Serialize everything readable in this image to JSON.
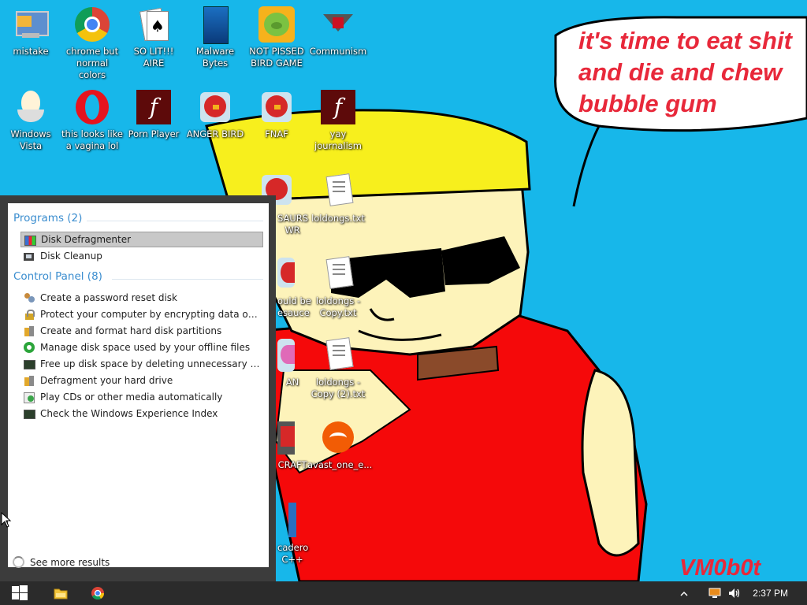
{
  "wallpaper": {
    "speech_text_1": "it's time to eat shit",
    "speech_text_2": "and die and chew",
    "speech_text_3": "bubble gum",
    "signature": "VM0b0t"
  },
  "desktop_icons": [
    {
      "label": "mistake",
      "icon": "computer-icon"
    },
    {
      "label": "chrome but normal colors",
      "icon": "chrome-icon"
    },
    {
      "label": "SO LIT!!! AIRE",
      "icon": "solitaire-icon"
    },
    {
      "label": "Malware Bytes",
      "icon": "malwarebytes-icon"
    },
    {
      "label": "NOT PISSED BIRD GAME",
      "icon": "pig-icon"
    },
    {
      "label": "Communism",
      "icon": "communism-icon"
    },
    {
      "label": "Windows Vista",
      "icon": "egg-icon"
    },
    {
      "label": "this looks like a vagina lol",
      "icon": "opera-icon"
    },
    {
      "label": "Porn Player",
      "icon": "flash-icon"
    },
    {
      "label": "ANGER BIRD",
      "icon": "angry-bird-icon"
    },
    {
      "label": "FNAF",
      "icon": "angry-bird-icon"
    },
    {
      "label": "yay journalism",
      "icon": "flash-icon"
    },
    {
      "label": "SAURS\nWR",
      "icon": "angry-bird-icon"
    },
    {
      "label": "loldongs.txt",
      "icon": "text-file-icon"
    },
    {
      "label": "ould be\nesauce",
      "icon": "angry-bird-icon"
    },
    {
      "label": "loldongs - Copy.txt",
      "icon": "text-file-icon"
    },
    {
      "label": "AN",
      "icon": "angry-bird-icon"
    },
    {
      "label": "loldongs - Copy (2).txt",
      "icon": "text-file-icon"
    },
    {
      "label": "CRAFT",
      "icon": "angry-bird-icon"
    },
    {
      "label": "avast_one_e...",
      "icon": "avast-icon"
    },
    {
      "label": "cadero\nC++",
      "icon": "app-icon"
    }
  ],
  "start_menu": {
    "programs_title": "Programs (2)",
    "programs": [
      {
        "label": "Disk Defragmenter",
        "icon": "defrag-icon",
        "selected": true
      },
      {
        "label": "Disk Cleanup",
        "icon": "cleanup-icon",
        "selected": false
      }
    ],
    "control_panel_title": "Control Panel (8)",
    "control_panel": [
      {
        "label": "Create a password reset disk",
        "icon": "users-icon"
      },
      {
        "label": "Protect your computer by encrypting data on your ...",
        "icon": "lock-icon"
      },
      {
        "label": "Create and format hard disk partitions",
        "icon": "tools-icon"
      },
      {
        "label": "Manage disk space used by your offline files",
        "icon": "sync-icon"
      },
      {
        "label": "Free up disk space by deleting unnecessary files",
        "icon": "monitor-icon"
      },
      {
        "label": "Defragment your hard drive",
        "icon": "tools-icon"
      },
      {
        "label": "Play CDs or other media automatically",
        "icon": "autoplay-icon"
      },
      {
        "label": "Check the Windows Experience Index",
        "icon": "monitor-icon"
      }
    ],
    "see_more": "See more results"
  },
  "taskbar": {
    "clock": "2:37 PM",
    "start_icon": "windows-logo-icon",
    "pinned": [
      "folder-icon",
      "chrome-icon"
    ],
    "tray": [
      "chevron-up-icon",
      "network-icon",
      "volume-icon"
    ]
  }
}
